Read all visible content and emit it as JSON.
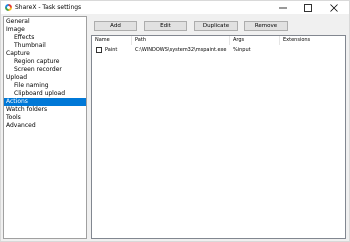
{
  "window": {
    "title": "ShareX - Task settings"
  },
  "nav": {
    "items": [
      {
        "label": "General",
        "level": 0,
        "selected": false
      },
      {
        "label": "Image",
        "level": 0,
        "selected": false
      },
      {
        "label": "Effects",
        "level": 1,
        "selected": false
      },
      {
        "label": "Thumbnail",
        "level": 1,
        "selected": false
      },
      {
        "label": "Capture",
        "level": 0,
        "selected": false
      },
      {
        "label": "Region capture",
        "level": 1,
        "selected": false
      },
      {
        "label": "Screen recorder",
        "level": 1,
        "selected": false
      },
      {
        "label": "Upload",
        "level": 0,
        "selected": false
      },
      {
        "label": "File naming",
        "level": 1,
        "selected": false
      },
      {
        "label": "Clipboard upload",
        "level": 1,
        "selected": false
      },
      {
        "label": "Actions",
        "level": 0,
        "selected": true
      },
      {
        "label": "Watch folders",
        "level": 0,
        "selected": false
      },
      {
        "label": "Tools",
        "level": 0,
        "selected": false
      },
      {
        "label": "Advanced",
        "level": 0,
        "selected": false
      }
    ]
  },
  "toolbar": {
    "add_label": "Add",
    "edit_label": "Edit",
    "duplicate_label": "Duplicate",
    "remove_label": "Remove"
  },
  "actions_list": {
    "columns": [
      "Name",
      "Path",
      "Args",
      "Extensions"
    ],
    "rows": [
      {
        "checked": false,
        "name": "Paint",
        "path": "C:\\WINDOWS\\system32\\mspaint.exe",
        "args": "%input",
        "extensions": ""
      }
    ]
  },
  "colors": {
    "selection": "#0078d7",
    "window_bg": "#f0f0f0"
  }
}
